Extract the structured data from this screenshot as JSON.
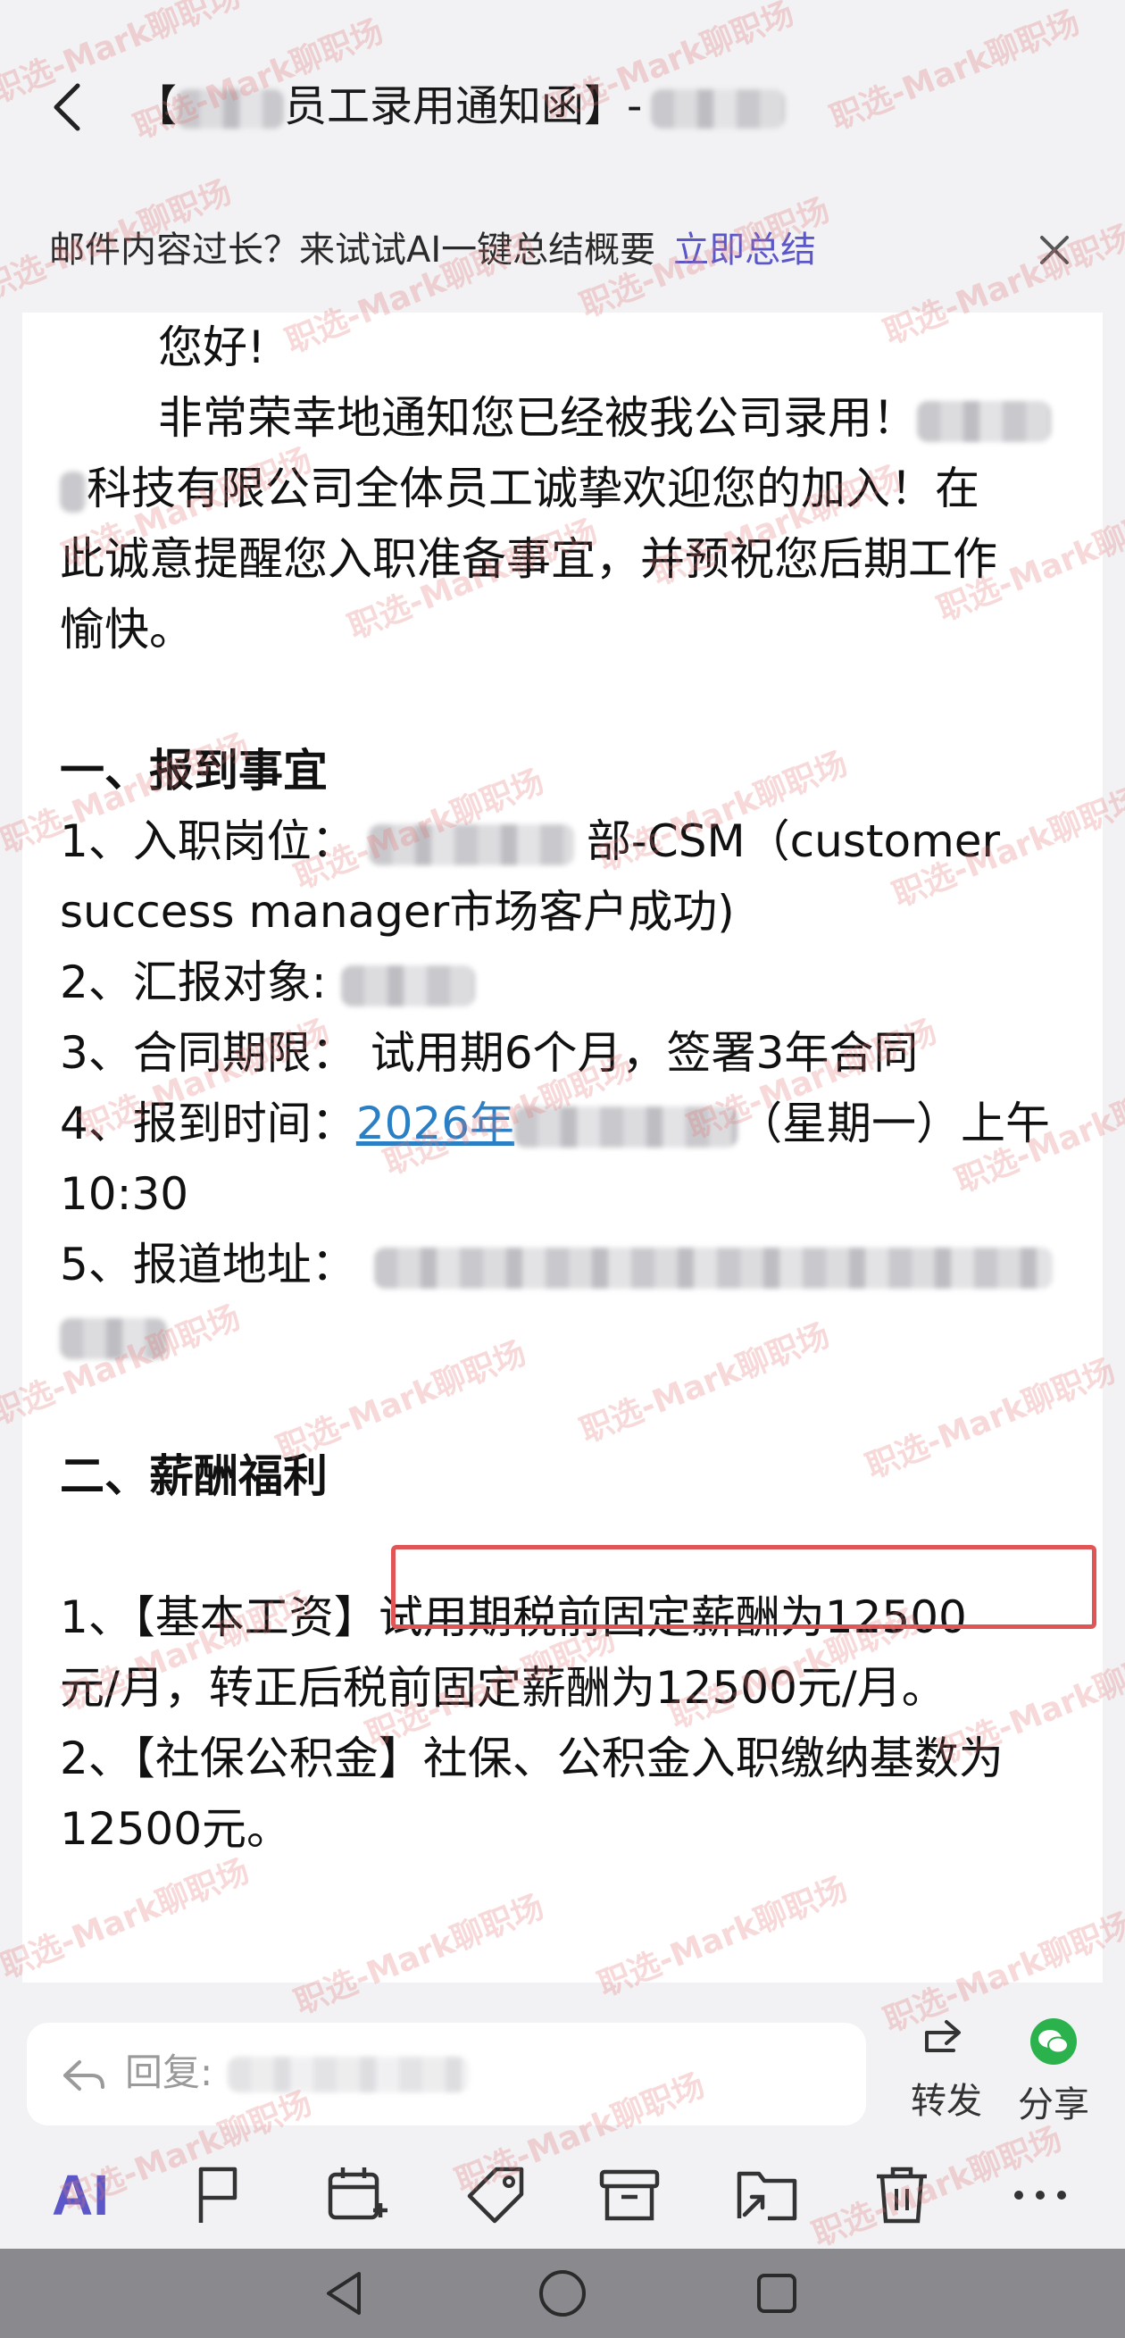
{
  "header": {
    "subject_open": "【",
    "subject_main": "员工录用通知函】-"
  },
  "banner": {
    "text": "邮件内容过长？来试试AI一键总结概要",
    "link": "立即总结"
  },
  "mail": {
    "greeting": "您好!",
    "intro_1": "非常荣幸地通知您已经被我公司录用！",
    "intro_2": "科技有限公司全体员工诚挚欢迎您的加入！在",
    "intro_3": "此诚意提醒您入职准备事宜，并预祝您后期工作",
    "intro_4": "愉快。",
    "section1_title": "一、报到事宜",
    "item1_label": "1、入职岗位：",
    "item1_value": "部-CSM（customer",
    "item1_cont": "success manager市场客户成功)",
    "item2_label": "2、汇报对象:",
    "item3": "3、合同期限：  试用期6个月，签署3年合同",
    "item4_label": "4、报到时间：",
    "item4_link": "2026年",
    "item4_tail": "（星期一）上午",
    "item4_cont": "10:30",
    "item5_label": "5、报道地址：",
    "section2_title": "二、薪酬福利",
    "salary_1a": "1、【基本工资】",
    "salary_1b": "试用期税前固定薪酬为12500",
    "salary_1c": "元/月，转正后税前固定薪酬为12500元/月。",
    "salary_2a": "2、【社保公积金】社保、公积金入职缴纳基数为",
    "salary_2b": "12500元。"
  },
  "reply": {
    "placeholder": "回复:",
    "forward_label": "转发",
    "share_label": "分享"
  },
  "toolbar": {
    "ai_label": "AI"
  },
  "watermark": {
    "text": "职选-Mark聊职场"
  },
  "colors": {
    "accent": "#5b57c8",
    "link": "#2b7fc4",
    "highlight_border": "#e05656",
    "wechat_green": "#2bb24c"
  }
}
